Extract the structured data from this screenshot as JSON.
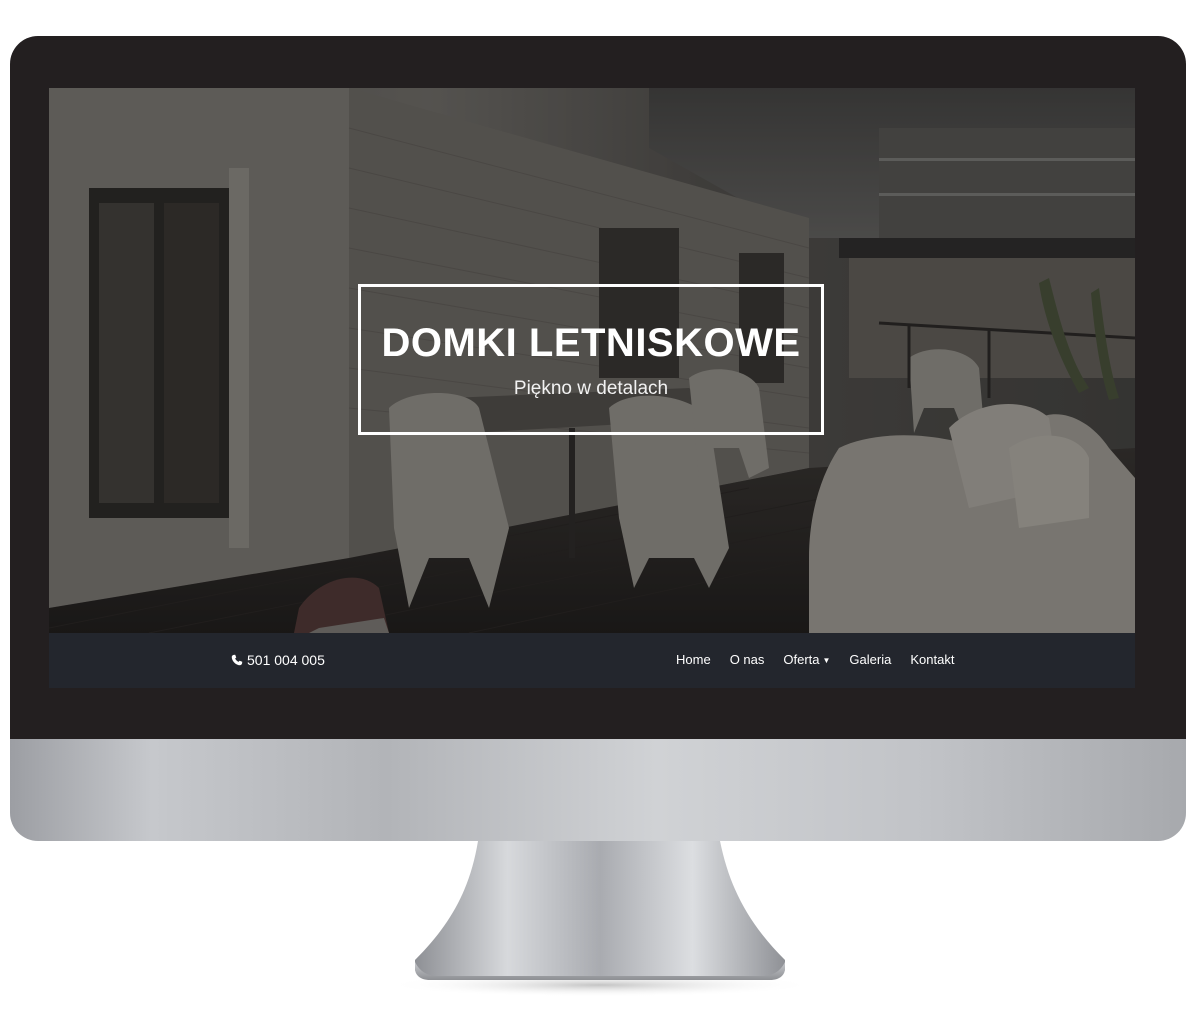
{
  "hero": {
    "title": "DOMKI LETNISKOWE",
    "subtitle": "Piękno w detalach"
  },
  "navbar": {
    "phone": "501 004 005",
    "phone_icon": "phone-icon",
    "items": [
      {
        "label": "Home"
      },
      {
        "label": "O nas"
      },
      {
        "label": "Oferta",
        "has_dropdown": true
      },
      {
        "label": "Galeria"
      },
      {
        "label": "Kontakt"
      }
    ]
  },
  "colors": {
    "bezel": "#231f20",
    "navbar": "#23262d",
    "text": "#ffffff"
  }
}
